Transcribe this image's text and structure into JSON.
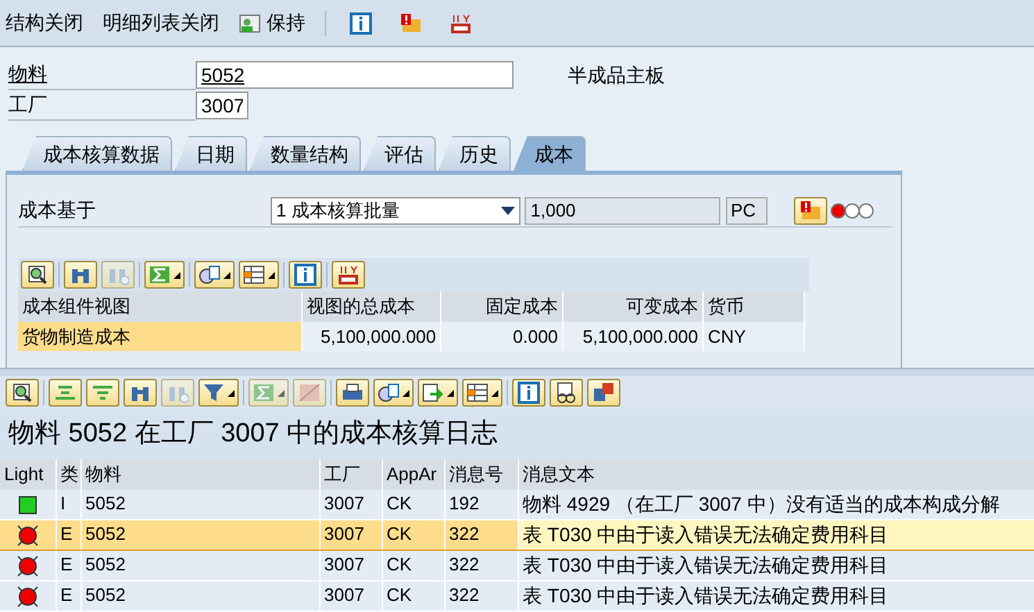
{
  "toolbar": {
    "buttons": [
      {
        "label": "结构关闭"
      },
      {
        "label": "明细列表关闭"
      },
      {
        "label": "保持"
      }
    ]
  },
  "header": {
    "material_label": "物料",
    "material_value": "5052",
    "material_description": "半成品主板",
    "plant_label": "工厂",
    "plant_value": "3007"
  },
  "tabs": [
    {
      "label": "成本核算数据",
      "selected": false
    },
    {
      "label": "日期",
      "selected": false
    },
    {
      "label": "数量结构",
      "selected": false
    },
    {
      "label": "评估",
      "selected": false
    },
    {
      "label": "历史",
      "selected": false
    },
    {
      "label": "成本",
      "selected": true
    }
  ],
  "cost_panel": {
    "basis_label": "成本基于",
    "basis_value": "1 成本核算批量",
    "quantity": "1,000",
    "unit": "PC",
    "status_light": {
      "color": "#ee0000"
    },
    "table": {
      "columns": [
        "成本组件视图",
        "视图的总成本",
        "固定成本",
        "可变成本",
        "货币"
      ],
      "rows": [
        {
          "selected": true,
          "cells": [
            "货物制造成本",
            "5,100,000.000",
            "0.000",
            "5,100,000.000",
            "CNY"
          ]
        }
      ]
    }
  },
  "log": {
    "title": "物料 5052 在工厂 3007 中的成本核算日志",
    "columns": [
      "Light",
      "类",
      "物料",
      "工厂",
      "AppAr",
      "消息号",
      "消息文本"
    ],
    "rows": [
      {
        "kind": "success",
        "color": "#22cc22",
        "selected": false,
        "cells": [
          "",
          "I",
          "5052",
          "3007",
          "CK",
          "192",
          "物料 4929 （在工厂 3007 中）没有适当的成本构成分解"
        ]
      },
      {
        "kind": "error",
        "color": "#ee0000",
        "selected": true,
        "cells": [
          "",
          "E",
          "5052",
          "3007",
          "CK",
          "322",
          "表 T030 中由于读入错误无法确定费用科目"
        ]
      },
      {
        "kind": "error",
        "color": "#ee0000",
        "selected": false,
        "cells": [
          "",
          "E",
          "5052",
          "3007",
          "CK",
          "322",
          "表 T030 中由于读入错误无法确定费用科目"
        ]
      },
      {
        "kind": "error",
        "color": "#ee0000",
        "selected": false,
        "cells": [
          "",
          "E",
          "5052",
          "3007",
          "CK",
          "322",
          "表 T030 中由于读入错误无法确定费用科目"
        ]
      }
    ]
  }
}
